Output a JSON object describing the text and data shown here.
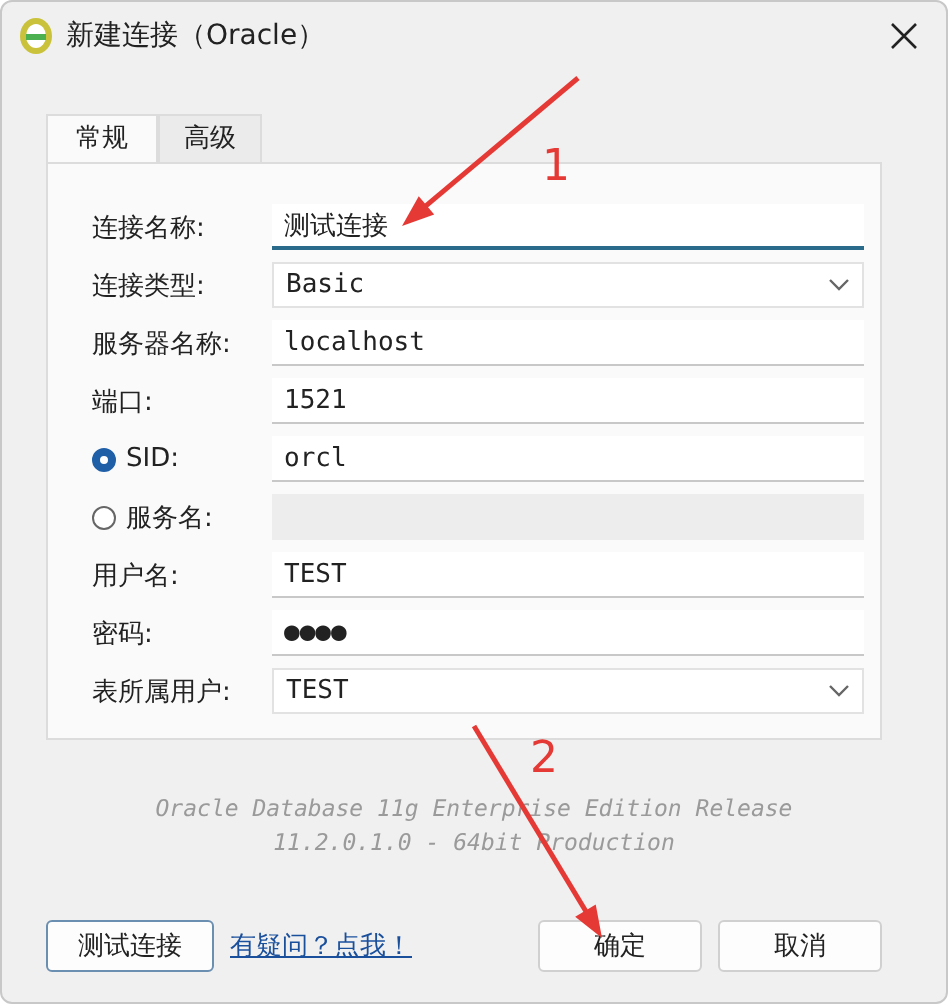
{
  "window": {
    "title": "新建连接（Oracle）"
  },
  "tabs": [
    {
      "label": "常规",
      "selected": true
    },
    {
      "label": "高级",
      "selected": false
    }
  ],
  "fields": [
    {
      "kind": "text",
      "label": "连接名称:",
      "value": "测试连接",
      "focused": true
    },
    {
      "kind": "select",
      "label": "连接类型:",
      "value": "Basic"
    },
    {
      "kind": "text",
      "label": "服务器名称:",
      "value": "localhost",
      "focused": false
    },
    {
      "kind": "text",
      "label": "端口:",
      "value": "1521",
      "focused": false
    },
    {
      "kind": "radio",
      "label": "SID:",
      "value": "orcl",
      "selected": true,
      "disabled": false
    },
    {
      "kind": "radio",
      "label": "服务名:",
      "selected": false,
      "disabled": true
    },
    {
      "kind": "text",
      "label": "用户名:",
      "value": "TEST",
      "focused": false
    },
    {
      "kind": "text",
      "label": "密码:",
      "value": "●●●●",
      "focused": false
    },
    {
      "kind": "select",
      "label": "表所属用户:",
      "value": "TEST"
    }
  ],
  "version_lines": [
    "Oracle Database 11g Enterprise Edition Release",
    "11.2.0.1.0 - 64bit Production"
  ],
  "test_button": "测试连接",
  "help_link": "有疑问？点我！",
  "buttons": [
    "确定",
    "取消"
  ],
  "annotations": [
    {
      "label": "1"
    },
    {
      "label": "2"
    }
  ]
}
